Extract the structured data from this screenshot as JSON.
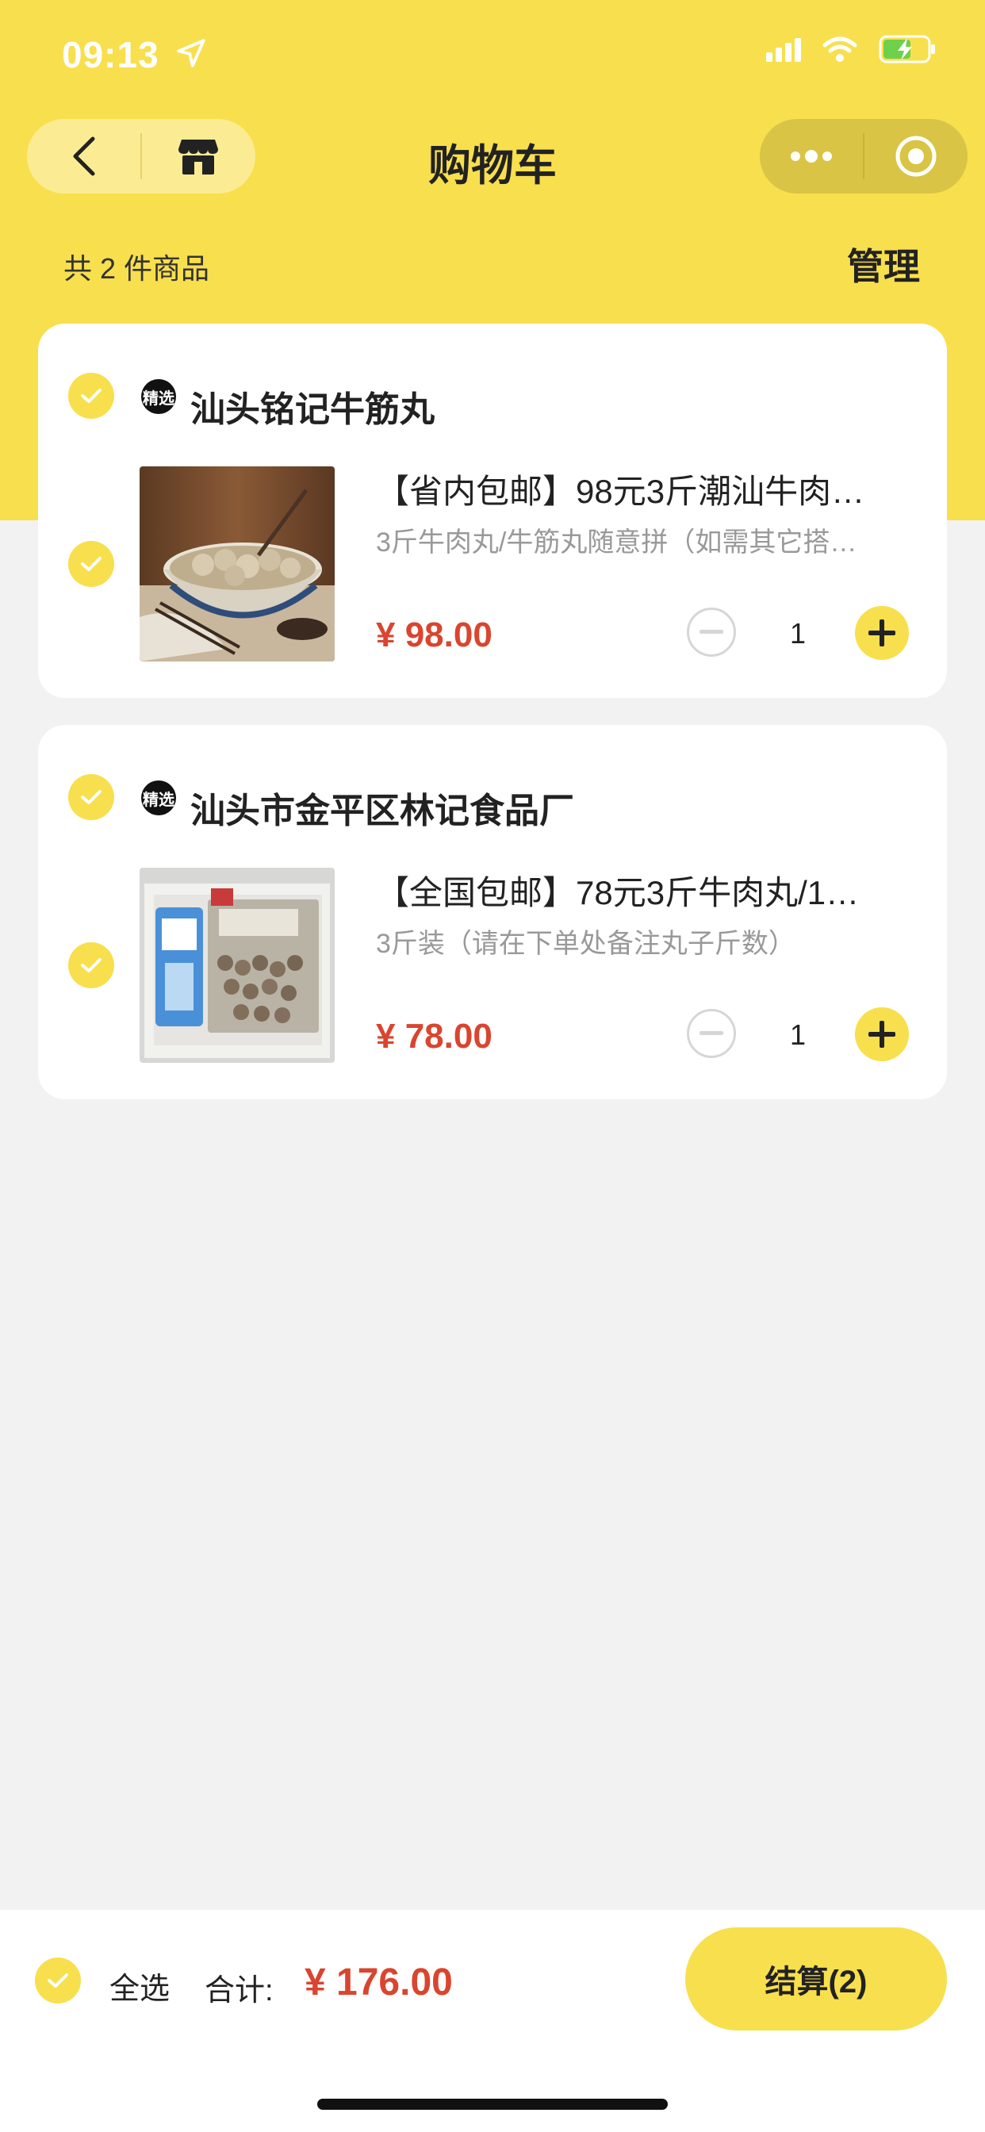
{
  "status": {
    "time": "09:13"
  },
  "nav": {
    "title": "购物车"
  },
  "summary": {
    "count_text": "共 2 件商品",
    "manage": "管理"
  },
  "shops": [
    {
      "name": "汕头铭记牛筋丸",
      "badge": "精选",
      "item": {
        "title": "【省内包邮】98元3斤潮汕牛肉…",
        "spec": "3斤牛肉丸/牛筋丸随意拼（如需其它搭…",
        "price": "¥ 98.00",
        "quantity": "1"
      }
    },
    {
      "name": "汕头市金平区林记食品厂",
      "badge": "精选",
      "item": {
        "title": "【全国包邮】78元3斤牛肉丸/1…",
        "spec": "3斤装（请在下单处备注丸子斤数）",
        "price": "¥ 78.00",
        "quantity": "1"
      }
    }
  ],
  "footer": {
    "select_all": "全选",
    "total_label": "合计:",
    "total_value": "¥ 176.00",
    "checkout": "结算(2)"
  },
  "colors": {
    "accent": "#f8df4d",
    "price": "#d9452f"
  }
}
